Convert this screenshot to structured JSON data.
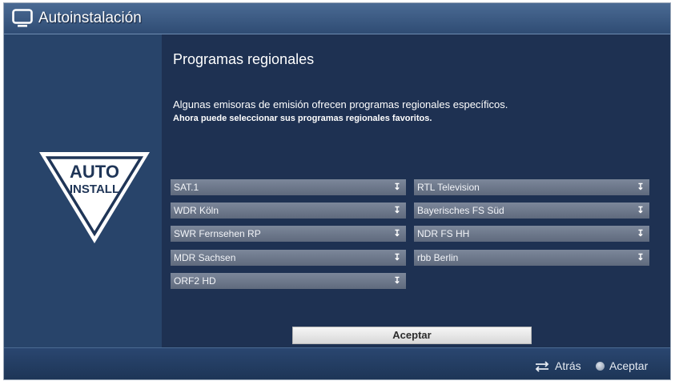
{
  "window": {
    "title": "Autoinstalación"
  },
  "logo": {
    "line1": "AUTO",
    "line2": "INSTALL"
  },
  "content": {
    "heading": "Programas regionales",
    "description_line1": "Algunas emisoras de emisión ofrecen programas regionales específicos.",
    "description_line2": "Ahora puede seleccionar sus programas regionales favoritos."
  },
  "selectors": {
    "left": [
      "SAT.1",
      "WDR Köln",
      "SWR Fernsehen RP",
      "MDR Sachsen",
      "ORF2 HD"
    ],
    "right": [
      "RTL Television",
      "Bayerisches FS Süd",
      "NDR FS HH",
      "rbb Berlin"
    ]
  },
  "buttons": {
    "accept": "Aceptar"
  },
  "footer": {
    "back_label": "Atrás",
    "accept_label": "Aceptar"
  },
  "icons": {
    "window": "tv-icon",
    "dropdown": "chevron-down-icon",
    "back": "back-arrows-icon",
    "ok": "ok-button-icon"
  },
  "colors": {
    "background": "#1e3152",
    "titlebar": "#3d5d87",
    "dropdown": "#6d788b",
    "button": "#e8e8e8"
  }
}
